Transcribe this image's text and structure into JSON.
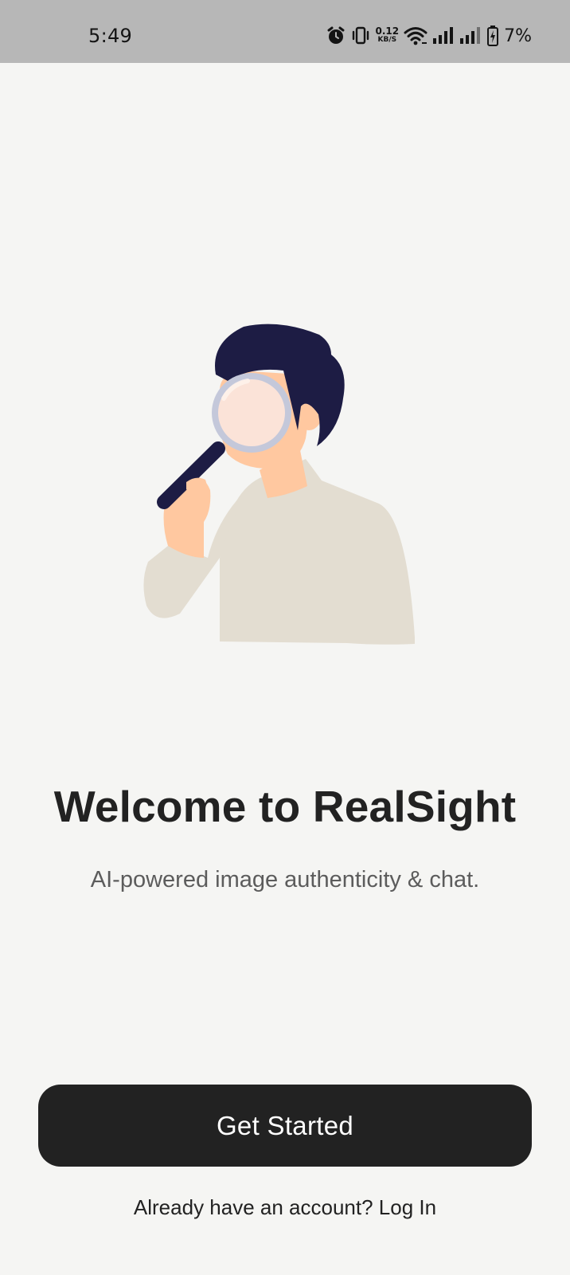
{
  "status_bar": {
    "time": "5:49",
    "net_speed_value": "0.12",
    "net_speed_unit": "KB/S",
    "battery_percent": "7%",
    "icons": [
      "alarm-icon",
      "vibrate-icon",
      "wifi-icon",
      "signal-icon",
      "signal-icon",
      "battery-charging-icon"
    ]
  },
  "illustration": {
    "name": "person-with-magnifying-glass",
    "colors": {
      "hair": "#1d1c44",
      "skin": "#ffc8a0",
      "shirt": "#e3ddd1",
      "lens_rim": "#c4c8da",
      "lens_glass": "#fbe3d8",
      "handle": "#1d1c44"
    }
  },
  "welcome": {
    "title": "Welcome to RealSight",
    "subtitle": "AI-powered image authenticity & chat."
  },
  "actions": {
    "get_started_label": "Get Started",
    "login_prompt": "Already have an account? Log In"
  },
  "colors": {
    "background": "#f5f5f3",
    "status_bar": "#b7b7b7",
    "primary_button": "#222222",
    "title_text": "#222222",
    "subtitle_text": "#5c5c5c"
  }
}
